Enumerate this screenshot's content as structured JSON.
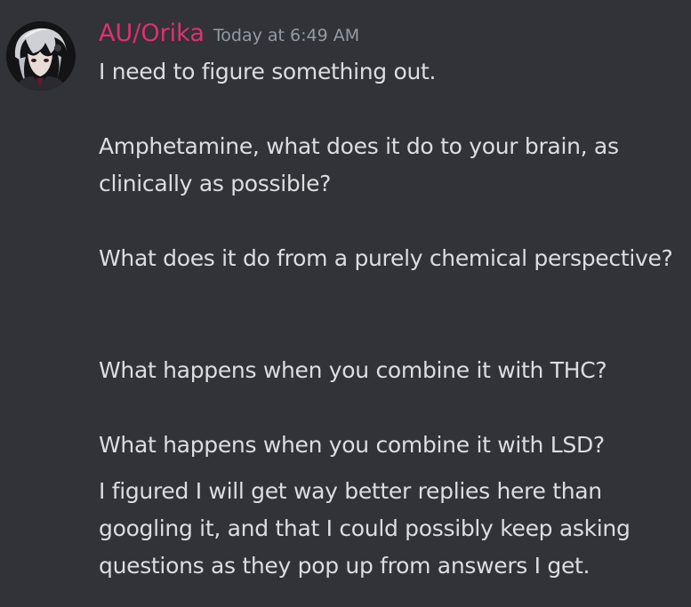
{
  "message": {
    "author": "AU/Orika",
    "timestamp": "Today at 6:49 AM",
    "author_color": "#e0306f",
    "avatar_icon": "anime-character-avatar",
    "lines": [
      "I need to figure something out.",
      "Amphetamine, what does it do to your brain, as clinically as possible?",
      "What does it do from a purely chemical perspective?",
      "What happens when you combine it with THC?",
      "What happens when you combine it with LSD?"
    ],
    "followup": "I figured I will get way better replies here than googling it, and that I could possibly keep asking questions as they pop up from answers I get."
  },
  "theme": {
    "background": "#313338",
    "text": "#dbdee1",
    "muted": "#949ba4"
  }
}
